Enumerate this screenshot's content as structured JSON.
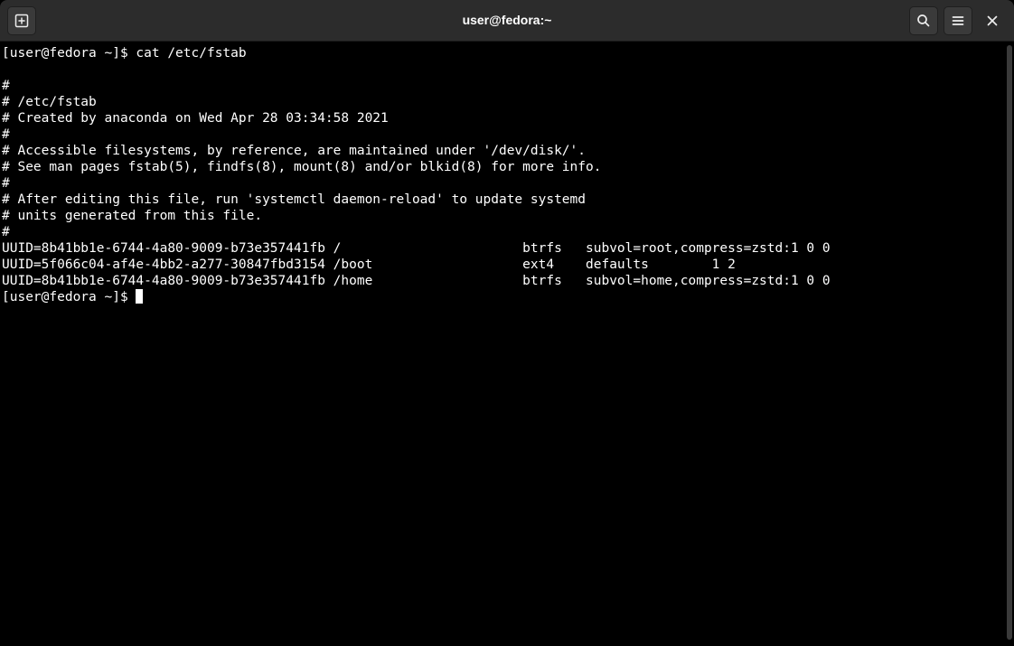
{
  "window": {
    "title": "user@fedora:~"
  },
  "terminal": {
    "lines": [
      "[user@fedora ~]$ cat /etc/fstab",
      "",
      "#",
      "# /etc/fstab",
      "# Created by anaconda on Wed Apr 28 03:34:58 2021",
      "#",
      "# Accessible filesystems, by reference, are maintained under '/dev/disk/'.",
      "# See man pages fstab(5), findfs(8), mount(8) and/or blkid(8) for more info.",
      "#",
      "# After editing this file, run 'systemctl daemon-reload' to update systemd",
      "# units generated from this file.",
      "#",
      "UUID=8b41bb1e-6744-4a80-9009-b73e357441fb /                       btrfs   subvol=root,compress=zstd:1 0 0",
      "UUID=5f066c04-af4e-4bb2-a277-30847fbd3154 /boot                   ext4    defaults        1 2",
      "UUID=8b41bb1e-6744-4a80-9009-b73e357441fb /home                   btrfs   subvol=home,compress=zstd:1 0 0"
    ],
    "prompt": "[user@fedora ~]$ "
  }
}
